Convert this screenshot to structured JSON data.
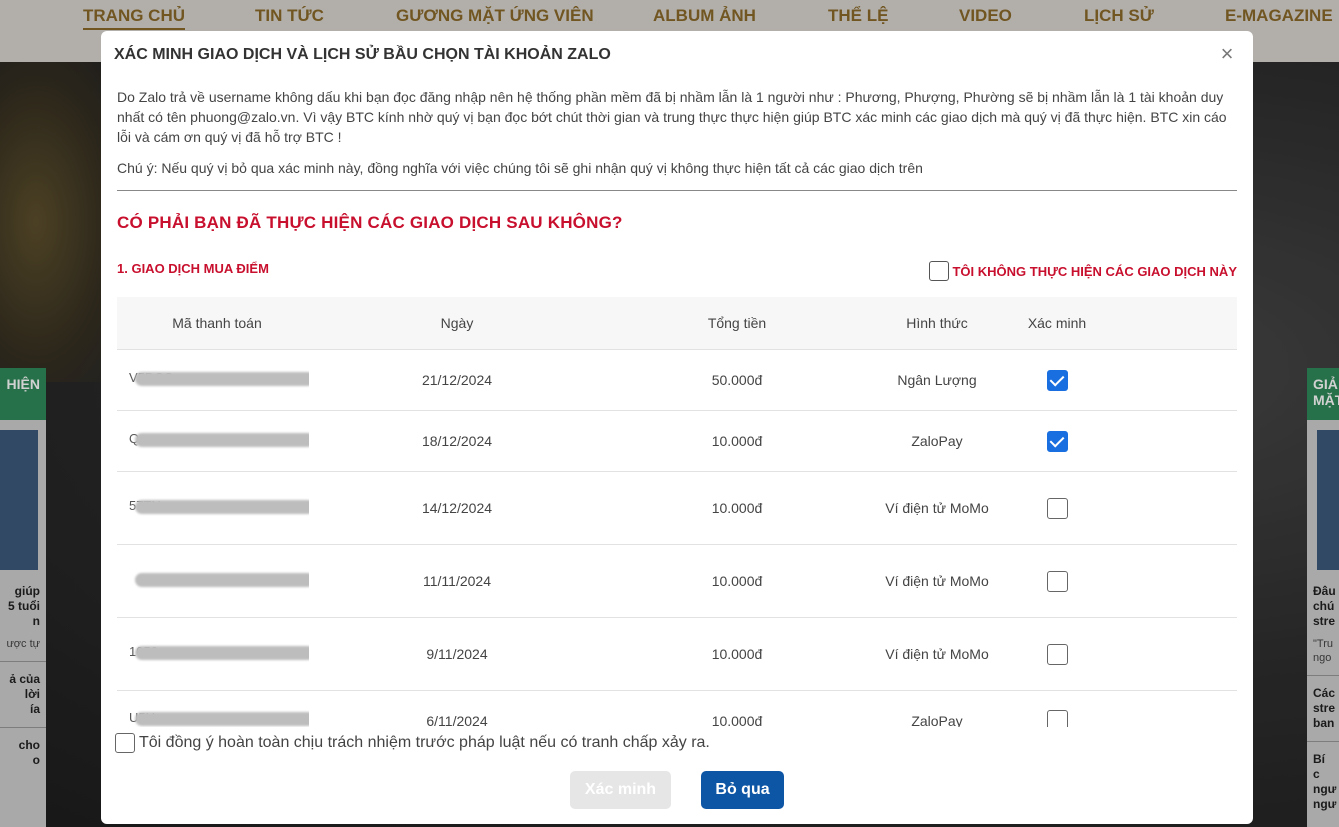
{
  "nav": [
    "TRANG CHỦ",
    "TIN TỨC",
    "GƯƠNG MẶT ỨNG VIÊN",
    "ALBUM ẢNH",
    "THỂ LỆ",
    "VIDEO",
    "LỊCH SỬ",
    "E-MAGAZINE"
  ],
  "side_left": {
    "header": "HIỆN",
    "text1": "giúp\n5 tuổi\nn",
    "text2": "ược tự",
    "text3": "ả của\nlời\nía",
    "text4": "cho\no"
  },
  "side_right": {
    "header": "GIẢ\nMẶT",
    "text1": "Đâu\nchú\nstre",
    "text2": "\"Tru\nngo",
    "text3": "Các\nstre\nban",
    "text4": "Bí c\nngư\nngư"
  },
  "modal": {
    "title": "XÁC MINH GIAO DỊCH VÀ LỊCH SỬ BẦU CHỌN TÀI KHOẢN ZALO",
    "close": "×",
    "intro": "Do Zalo trả về username không dấu khi bạn đọc đăng nhập nên hệ thống phần mềm đã bị nhầm lẫn là 1 người như : Phương, Phượng, Phường sẽ bị nhầm lẫn là 1 tài khoản duy nhất có tên phuong@zalo.vn. Vì vậy BTC kính nhờ quý vị bạn đọc bớt chút thời gian và trung thực thực hiện giúp BTC xác minh các giao dịch mà quý vị đã thực hiện. BTC xin cáo lỗi và cám ơn quý vị đã hỗ trợ BTC !",
    "note": "Chú ý: Nếu quý vị bỏ qua xác minh này, đồng nghĩa với việc chúng tôi sẽ ghi nhận quý vị không thực hiện tất cả các giao dịch trên",
    "question": "CÓ PHẢI BẠN ĐÃ THỰC HIỆN CÁC GIAO DỊCH SAU KHÔNG?",
    "section_title": "1. GIAO DỊCH MUA ĐIỂM",
    "not_done_label": "TÔI KHÔNG THỰC HIỆN CÁC GIAO DỊCH NÀY",
    "columns": [
      "Mã thanh toán",
      "Ngày",
      "Tổng tiền",
      "Hình thức",
      "Xác minh"
    ],
    "rows": [
      {
        "code": "V5DCC",
        "date": "21/12/2024",
        "amount": "50.000đ",
        "method": "Ngân Lượng",
        "verified": true
      },
      {
        "code": "Q",
        "date": "18/12/2024",
        "amount": "10.000đ",
        "method": "ZaloPay",
        "verified": true
      },
      {
        "code": "57TN",
        "date": "14/12/2024",
        "amount": "10.000đ",
        "method": "Ví điện tử MoMo",
        "verified": false
      },
      {
        "code": "",
        "date": "11/11/2024",
        "amount": "10.000đ",
        "method": "Ví điện tử MoMo",
        "verified": false
      },
      {
        "code": "1050",
        "date": "9/11/2024",
        "amount": "10.000đ",
        "method": "Ví điện tử MoMo",
        "verified": false
      },
      {
        "code": "U5U",
        "date": "6/11/2024",
        "amount": "10.000đ",
        "method": "ZaloPay",
        "verified": false
      }
    ],
    "agree_label": "Tôi đồng ý hoàn toàn chịu trách nhiệm trước pháp luật nếu có tranh chấp xảy ra.",
    "confirm_button": "Xác minh",
    "skip_button": "Bỏ qua"
  },
  "colors": {
    "accent_red": "#c8102e",
    "primary_blue": "#0d55a5",
    "checkbox_blue": "#1a6fe0",
    "nav_gold": "#8a6a2a"
  }
}
